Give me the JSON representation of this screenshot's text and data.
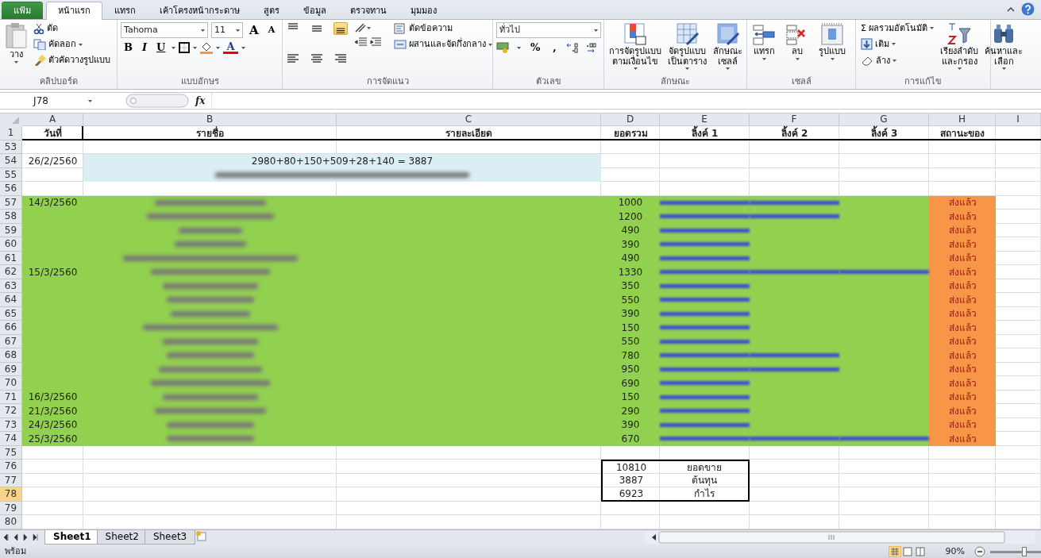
{
  "tabs": [
    {
      "label": "แฟ้ม",
      "kind": "file",
      "selected": false
    },
    {
      "label": "หน้าแรก",
      "kind": "tab",
      "selected": true
    },
    {
      "label": "แทรก",
      "kind": "tab",
      "selected": false
    },
    {
      "label": "เค้าโครงหน้ากระดาษ",
      "kind": "tab",
      "selected": false
    },
    {
      "label": "สูตร",
      "kind": "tab",
      "selected": false
    },
    {
      "label": "ข้อมูล",
      "kind": "tab",
      "selected": false
    },
    {
      "label": "ตรวจทาน",
      "kind": "tab",
      "selected": false
    },
    {
      "label": "มุมมอง",
      "kind": "tab",
      "selected": false
    }
  ],
  "ribbon": {
    "clipboard": {
      "paste": "วาง",
      "cut": "ตัด",
      "copy": "คัดลอก",
      "format_painter": "ตัวคัดวางรูปแบบ",
      "label": "คลิปบอร์ด"
    },
    "font": {
      "name": "Tahoma",
      "size": "11",
      "grow": "A",
      "shrink": "A",
      "bold": "B",
      "italic": "I",
      "underline": "U",
      "font_color": "A",
      "label": "แบบอักษร"
    },
    "alignment": {
      "bottom_align_selected": true,
      "wrap": "ตัดข้อความ",
      "merge": "ผสานและจัดกึ่งกลาง",
      "label": "การจัดแนว"
    },
    "number": {
      "format": "ทั่วไป",
      "percent": "%",
      "comma": ",",
      "label": "ตัวเลข"
    },
    "styles": {
      "conditional": [
        "การจัดรูปแบบ",
        "ตามเงื่อนไข"
      ],
      "table": [
        "จัดรูปแบบ",
        "เป็นตาราง"
      ],
      "cell_styles": [
        "ลักษณะ",
        "เซลล์"
      ],
      "label": "ลักษณะ"
    },
    "cells": {
      "insert": "แทรก",
      "delete": "ลบ",
      "format": "รูปแบบ",
      "label": "เซลล์"
    },
    "editing": {
      "sigma": "Σ",
      "autosum": "ผลรวมอัตโนมัติ",
      "fill": "เติม",
      "clear": "ล้าง",
      "sort": [
        "เรียงลำดับ",
        "และกรอง"
      ],
      "find": [
        "ค้นหาและ",
        "เลือก"
      ],
      "label": "การแก้ไข"
    }
  },
  "formula_bar": {
    "name_box": "J78",
    "fx": "fx"
  },
  "columns": [
    {
      "letter": "A",
      "heading": "วันที่"
    },
    {
      "letter": "B",
      "heading": "รายชื่อ"
    },
    {
      "letter": "C",
      "heading": "รายละเอียด"
    },
    {
      "letter": "D",
      "heading": "ยอดรวม"
    },
    {
      "letter": "E",
      "heading": "ลิ้งค์ 1"
    },
    {
      "letter": "F",
      "heading": "ลิ้งค์ 2"
    },
    {
      "letter": "G",
      "heading": "ลิ้งค์ 3"
    },
    {
      "letter": "H",
      "heading": "สถานะของ"
    },
    {
      "letter": "I"
    }
  ],
  "header_row": {
    "number": "1",
    "selected": false
  },
  "rows": [
    {
      "number": "53",
      "selected": false
    },
    {
      "number": "54",
      "selected": false,
      "date": "26/2/2560",
      "color": "#daeef3",
      "merged_text": "2980+80+150+509+28+140 = 3887"
    },
    {
      "number": "55",
      "selected": false,
      "color": "#daeef3",
      "merged_blurred": true
    },
    {
      "number": "56",
      "selected": false
    },
    {
      "number": "57",
      "selected": false,
      "date": "14/3/2560",
      "color": "#92d050",
      "name_blurred": true,
      "total": "1000",
      "links": [
        {
          "blurred": true
        },
        {
          "blurred": true
        }
      ],
      "status": {
        "text": "ส่งแล้ว",
        "color": "#f79646"
      }
    },
    {
      "number": "58",
      "selected": false,
      "color": "#92d050",
      "name_blurred": true,
      "total": "1200",
      "links": [
        {
          "blurred": true
        },
        {
          "blurred": true
        }
      ],
      "status": {
        "text": "ส่งแล้ว",
        "color": "#f79646"
      }
    },
    {
      "number": "59",
      "selected": false,
      "color": "#92d050",
      "name_blurred": true,
      "total": "490",
      "links": [
        {
          "blurred": true
        }
      ],
      "status": {
        "text": "ส่งแล้ว",
        "color": "#f79646"
      }
    },
    {
      "number": "60",
      "selected": false,
      "color": "#92d050",
      "name_blurred": true,
      "total": "390",
      "links": [
        {
          "blurred": true
        }
      ],
      "status": {
        "text": "ส่งแล้ว",
        "color": "#f79646"
      }
    },
    {
      "number": "61",
      "selected": false,
      "color": "#92d050",
      "name_blurred": true,
      "total": "490",
      "links": [
        {
          "blurred": true
        }
      ],
      "status": {
        "text": "ส่งแล้ว",
        "color": "#f79646"
      }
    },
    {
      "number": "62",
      "selected": false,
      "date": "15/3/2560",
      "color": "#92d050",
      "name_blurred": true,
      "total": "1330",
      "links": [
        {
          "blurred": true
        },
        {
          "blurred": true
        },
        {
          "blurred": true
        }
      ],
      "status": {
        "text": "ส่งแล้ว",
        "color": "#f79646"
      }
    },
    {
      "number": "63",
      "selected": false,
      "color": "#92d050",
      "name_blurred": true,
      "total": "350",
      "links": [
        {
          "blurred": true
        }
      ],
      "status": {
        "text": "ส่งแล้ว",
        "color": "#f79646"
      }
    },
    {
      "number": "64",
      "selected": false,
      "color": "#92d050",
      "name_blurred": true,
      "total": "550",
      "links": [
        {
          "blurred": true
        }
      ],
      "status": {
        "text": "ส่งแล้ว",
        "color": "#f79646"
      }
    },
    {
      "number": "65",
      "selected": false,
      "color": "#92d050",
      "name_blurred": true,
      "total": "390",
      "links": [
        {
          "blurred": true
        }
      ],
      "status": {
        "text": "ส่งแล้ว",
        "color": "#f79646"
      }
    },
    {
      "number": "66",
      "selected": false,
      "color": "#92d050",
      "name_blurred": true,
      "total": "150",
      "links": [
        {
          "blurred": true
        }
      ],
      "status": {
        "text": "ส่งแล้ว",
        "color": "#f79646"
      }
    },
    {
      "number": "67",
      "selected": false,
      "color": "#92d050",
      "name_blurred": true,
      "total": "550",
      "links": [
        {
          "blurred": true
        }
      ],
      "status": {
        "text": "ส่งแล้ว",
        "color": "#f79646"
      }
    },
    {
      "number": "68",
      "selected": false,
      "color": "#92d050",
      "name_blurred": true,
      "total": "780",
      "links": [
        {
          "blurred": true
        },
        {
          "blurred": true
        }
      ],
      "status": {
        "text": "ส่งแล้ว",
        "color": "#f79646"
      }
    },
    {
      "number": "69",
      "selected": false,
      "color": "#92d050",
      "name_blurred": true,
      "total": "950",
      "links": [
        {
          "blurred": true
        },
        {
          "blurred": true
        }
      ],
      "status": {
        "text": "ส่งแล้ว",
        "color": "#f79646"
      }
    },
    {
      "number": "70",
      "selected": false,
      "color": "#92d050",
      "name_blurred": true,
      "total": "690",
      "links": [
        {
          "blurred": true
        }
      ],
      "status": {
        "text": "ส่งแล้ว",
        "color": "#f79646"
      }
    },
    {
      "number": "71",
      "selected": false,
      "date": "16/3/2560",
      "color": "#92d050",
      "name_blurred": true,
      "total": "150",
      "links": [
        {
          "blurred": true
        }
      ],
      "status": {
        "text": "ส่งแล้ว",
        "color": "#f79646"
      }
    },
    {
      "number": "72",
      "selected": false,
      "date": "21/3/2560",
      "color": "#92d050",
      "name_blurred": true,
      "total": "290",
      "links": [
        {
          "blurred": true
        }
      ],
      "status": {
        "text": "ส่งแล้ว",
        "color": "#f79646"
      }
    },
    {
      "number": "73",
      "selected": false,
      "date": "24/3/2560",
      "color": "#92d050",
      "name_blurred": true,
      "total": "390",
      "links": [
        {
          "blurred": true
        }
      ],
      "status": {
        "text": "ส่งแล้ว",
        "color": "#f79646"
      }
    },
    {
      "number": "74",
      "selected": false,
      "date": "25/3/2560",
      "color": "#92d050",
      "name_blurred": true,
      "total": "670",
      "links": [
        {
          "blurred": true
        },
        {
          "blurred": true
        },
        {
          "blurred": true
        }
      ],
      "status": {
        "text": "ส่งแล้ว",
        "color": "#f79646"
      }
    },
    {
      "number": "75",
      "selected": false
    },
    {
      "number": "76",
      "selected": false,
      "summary_value": "10810",
      "summary_label": "ยอดขาย"
    },
    {
      "number": "77",
      "selected": false,
      "summary_value": "3887",
      "summary_label": "ต้นทุน"
    },
    {
      "number": "78",
      "selected": true,
      "summary_value": "6923",
      "summary_label": "กำไร"
    },
    {
      "number": "79",
      "selected": false
    },
    {
      "number": "80",
      "selected": false
    }
  ],
  "sheet_tabs": [
    {
      "label": "Sheet1",
      "selected": true
    },
    {
      "label": "Sheet2",
      "selected": false
    },
    {
      "label": "Sheet3",
      "selected": false
    }
  ],
  "status_bar": {
    "mode": "พร้อม",
    "zoom": "90%",
    "zoom_slider": {
      "level": 0.67
    }
  }
}
